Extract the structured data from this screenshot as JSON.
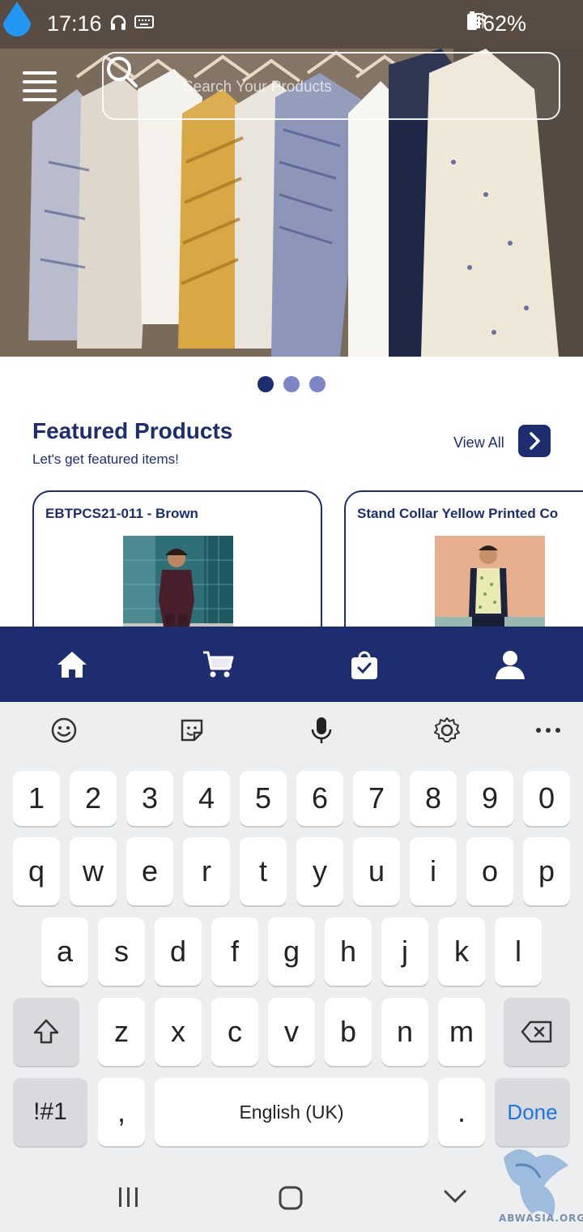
{
  "status_bar": {
    "time": "17:16",
    "battery": "62%"
  },
  "search": {
    "placeholder": "Search Your Products"
  },
  "carousel": {
    "dot_count": 3,
    "active_index": 0
  },
  "featured": {
    "title": "Featured Products",
    "subtitle": "Let's get featured items!",
    "view_all": "View All",
    "products": [
      {
        "name": "EBTPCS21-011 - Brown"
      },
      {
        "name": "Stand Collar Yellow Printed Co"
      }
    ]
  },
  "bottom_nav": {
    "items": [
      {
        "icon": "home-icon"
      },
      {
        "icon": "cart-icon"
      },
      {
        "icon": "shopping-bag-icon"
      },
      {
        "icon": "user-icon"
      }
    ]
  },
  "keyboard": {
    "toolbar": [
      "emoji-icon",
      "sticker-icon",
      "microphone-icon",
      "settings-icon",
      "more-icon"
    ],
    "row_numbers": [
      "1",
      "2",
      "3",
      "4",
      "5",
      "6",
      "7",
      "8",
      "9",
      "0"
    ],
    "row_1": [
      "q",
      "w",
      "e",
      "r",
      "t",
      "y",
      "u",
      "i",
      "o",
      "p"
    ],
    "row_2": [
      "a",
      "s",
      "d",
      "f",
      "g",
      "h",
      "j",
      "k",
      "l"
    ],
    "row_3": [
      "z",
      "x",
      "c",
      "v",
      "b",
      "n",
      "m"
    ],
    "symbols_key": "!#1",
    "comma_key": ",",
    "space_label": "English (UK)",
    "period_key": ".",
    "done_key": "Done"
  },
  "watermark": {
    "text": "ABWASIA.ORG"
  },
  "colors": {
    "brand": "#1e2d6f",
    "dot_inactive": "#7b85c8",
    "done": "#1a73e8"
  }
}
